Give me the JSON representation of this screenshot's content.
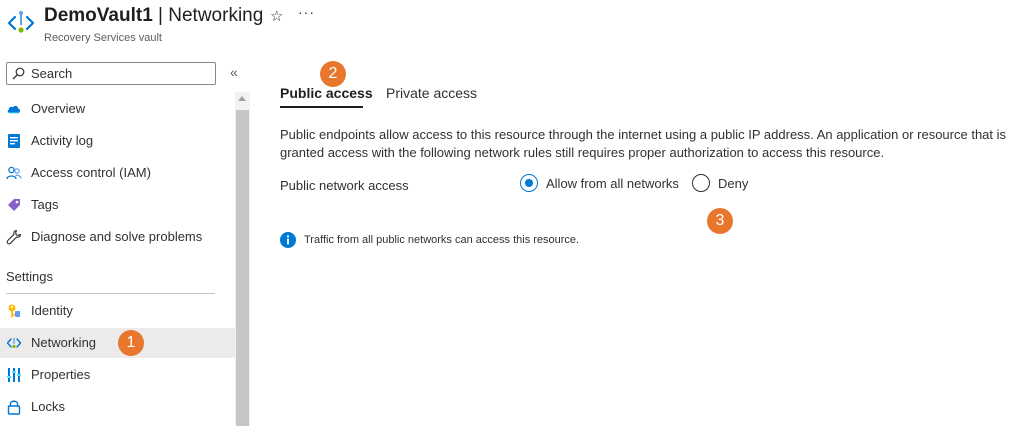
{
  "header": {
    "resource_name": "DemoVault1",
    "separator": " | ",
    "page_name": "Networking",
    "subtitle": "Recovery Services vault",
    "star_glyph": "☆",
    "more_glyph": "···"
  },
  "sidebar": {
    "search": {
      "placeholder": "Search"
    },
    "collapse_glyph": "«",
    "items": [
      {
        "label": "Overview",
        "icon": "overview-cloud-icon"
      },
      {
        "label": "Activity log",
        "icon": "activity-log-icon"
      },
      {
        "label": "Access control (IAM)",
        "icon": "people-icon"
      },
      {
        "label": "Tags",
        "icon": "tag-icon"
      },
      {
        "label": "Diagnose and solve problems",
        "icon": "wrench-icon"
      }
    ],
    "section_title": "Settings",
    "settings_items": [
      {
        "label": "Identity",
        "icon": "key-icon"
      },
      {
        "label": "Networking",
        "icon": "networking-icon",
        "selected": true
      },
      {
        "label": "Properties",
        "icon": "properties-icon"
      },
      {
        "label": "Locks",
        "icon": "lock-icon"
      }
    ]
  },
  "callouts": {
    "one": "1",
    "two": "2",
    "three": "3",
    "color": "#e8772e"
  },
  "main": {
    "tabs": [
      {
        "label": "Public access",
        "active": true
      },
      {
        "label": "Private access",
        "active": false
      }
    ],
    "description": "Public endpoints allow access to this resource through the internet using a public IP address. An application or resource that is granted access with the following network rules still requires proper authorization to access this resource.",
    "public_network_access": {
      "label": "Public network access",
      "options": [
        {
          "label": "Allow from all networks",
          "selected": true
        },
        {
          "label": "Deny",
          "selected": false
        }
      ]
    },
    "info_message": "Traffic from all public networks can access this resource."
  },
  "colors": {
    "accent": "#0078d4",
    "selected_bg": "#edebe9",
    "callout": "#e8772e"
  }
}
